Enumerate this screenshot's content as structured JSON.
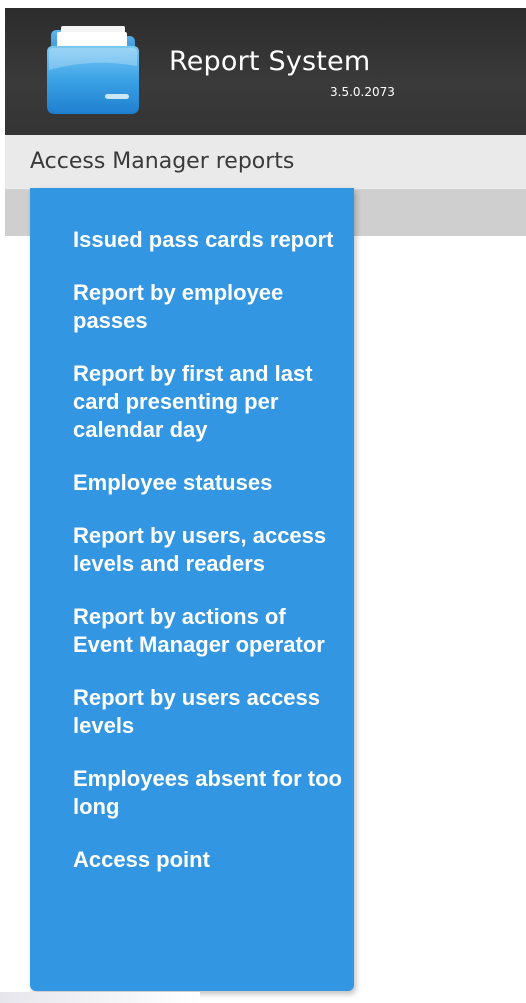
{
  "header": {
    "title": "Report System",
    "version": "3.5.0.2073",
    "icon": "folder-icon"
  },
  "menubar": {
    "label": "Access Manager reports"
  },
  "dropdown": {
    "items": [
      {
        "label": "Issued pass cards report"
      },
      {
        "label": "Report by employee passes"
      },
      {
        "label": "Report by first and last card presenting per calendar day"
      },
      {
        "label": "Employee statuses"
      },
      {
        "label": "Report by users, access levels and readers"
      },
      {
        "label": "Report by actions of Event Manager operator"
      },
      {
        "label": "Report by users access levels"
      },
      {
        "label": "Employees absent for too long"
      },
      {
        "label": "Access point"
      }
    ]
  },
  "colors": {
    "header_bg": "#333333",
    "menubar_bg": "#eaeaea",
    "dropdown_bg": "#3396e2",
    "dropdown_text": "#ffffff"
  }
}
